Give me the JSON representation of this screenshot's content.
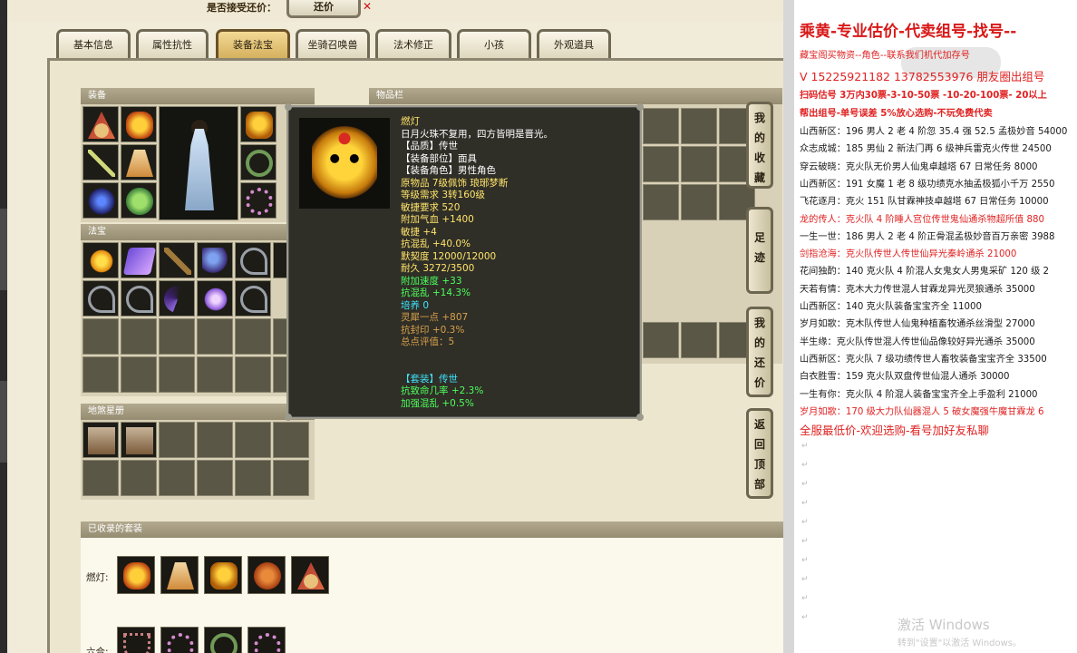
{
  "topbar": {
    "accept_label": "是否接受还价：",
    "accept_button": "还价",
    "close": "✕"
  },
  "tabs": [
    "基本信息",
    "属性抗性",
    "装备法宝",
    "坐骑召唤兽",
    "法术修正",
    "小孩",
    "外观道具"
  ],
  "sections": {
    "equipment": "装备",
    "treasure": "法宝",
    "items_bar": "物品栏",
    "pet_chart": "地煞星册",
    "collected_suits": "已收录的套装"
  },
  "suits": [
    {
      "label": "燃灯:"
    },
    {
      "label": "六合:"
    }
  ],
  "side_buttons": [
    {
      "label": "我的收藏",
      "chars": [
        "我",
        "的",
        "收",
        "藏"
      ]
    },
    {
      "label": "足迹",
      "chars": [
        "足",
        "迹"
      ]
    },
    {
      "label": "我的还价",
      "chars": [
        "我",
        "的",
        "还",
        "价"
      ]
    },
    {
      "label": "返回顶部",
      "chars": [
        "返",
        "回",
        "顶",
        "部"
      ]
    }
  ],
  "tooltip": {
    "lines": [
      {
        "text": "燃灯",
        "color": "#ffe46b"
      },
      {
        "text": "日月火珠不复用，四方皆明是晋光。",
        "color": "#ffffff"
      },
      {
        "text": "【品质】传世",
        "color": "#ffffff"
      },
      {
        "text": "【装备部位】面具",
        "color": "#ffffff"
      },
      {
        "text": "【装备角色】男性角色",
        "color": "#ffffff"
      },
      {
        "text": "原物品 7级佩饰 琅琊梦断",
        "color": "#ffe46b"
      },
      {
        "text": "等级需求 3转160级",
        "color": "#ffe46b"
      },
      {
        "text": "敏捷要求 520",
        "color": "#ffe46b"
      },
      {
        "text": "附加气血 +1400",
        "color": "#ffe46b"
      },
      {
        "text": "敏捷 +4",
        "color": "#ffe46b"
      },
      {
        "text": "抗混乱 +40.0%",
        "color": "#ffe46b"
      },
      {
        "text": "默契度 12000/12000",
        "color": "#ffe46b"
      },
      {
        "text": "耐久 3272/3500",
        "color": "#ffe46b"
      },
      {
        "text": "附加速度 +33",
        "color": "#4dff5c"
      },
      {
        "text": "抗混乱 +14.3%",
        "color": "#4dff5c"
      },
      {
        "text": "培养 0",
        "color": "#3ee6ff"
      },
      {
        "text": "灵犀一点 +807",
        "color": "#d7a14c"
      },
      {
        "text": "抗封印 +0.3%",
        "color": "#d7a14c"
      },
      {
        "text": "总点评值：5",
        "color": "#d7a14c"
      },
      {
        "text": "",
        "color": "#ffffff"
      },
      {
        "text": "",
        "color": "#ffffff"
      },
      {
        "text": "【套装】传世",
        "color": "#3ee6ff"
      },
      {
        "text": "抗致命几率 +2.3%",
        "color": "#4dff5c"
      },
      {
        "text": "加强混乱 +0.5%",
        "color": "#4dff5c"
      }
    ]
  },
  "document": {
    "title": "乘黄-专业估价-代卖组号-找号--",
    "lines": [
      {
        "text": "藏宝阁买物资--角色--联系我们机代加存号",
        "style": "red"
      },
      {
        "text": "V 15225921182    13782553976 朋友圈出组号",
        "style": "red big"
      },
      {
        "text": "扫码估号 3万内30票-3-10-50票  -10-20-100票- 20以上",
        "style": "redb"
      },
      {
        "text": "帮出组号-单号误差 5%放心选购-不玩免费代卖",
        "style": "redb"
      },
      {
        "text": "山西新区：196 男人 2 老 4 阶忽 35.4 强 52.5 孟极妙音 54000",
        "style": ""
      },
      {
        "text": "众志成城：185 男仙 2 新法门再 6 级神兵雷克火传世 24500",
        "style": ""
      },
      {
        "text": "穿云破晓：克火队无价男人仙鬼卓越塔 67 日常任务 8000",
        "style": ""
      },
      {
        "text": "山西新区：191 女魔 1 老 8 级功绩克水抽孟极狐小千万 2550",
        "style": ""
      },
      {
        "text": "飞花逐月：克火 151 队甘霖神技卓越塔 67 日常任务 10000",
        "style": ""
      },
      {
        "text": "龙的传人：克火队 4 阶睡人宫位传世鬼仙通杀物超所值 880",
        "style": "red"
      },
      {
        "text": "一生一世：186 男人 2 老 4 阶正骨混孟极妙音百万亲密 3988",
        "style": ""
      },
      {
        "text": "剑指沧海：克火队传世人传世仙异光秦岭通杀 21000",
        "style": "red"
      },
      {
        "text": "花间独酌：140 克火队 4 阶混人女鬼女人男鬼采矿 120 级 2",
        "style": ""
      },
      {
        "text": "天若有情：克木大力传世混人甘霖龙异光灵狼通杀 35000",
        "style": ""
      },
      {
        "text": "山西新区：140 克火队装备宝宝齐全 11000",
        "style": ""
      },
      {
        "text": "岁月如歌：克木队传世人仙鬼种植畜牧通杀丝滑型 27000",
        "style": ""
      },
      {
        "text": "半生缘：克火队传世混人传世仙品像较好异光通杀 35000",
        "style": ""
      },
      {
        "text": "山西新区：克火队 7 级功绩传世人畜牧装备宝宝齐全 33500",
        "style": ""
      },
      {
        "text": "白衣胜雪：159 克火队双盘传世仙混人通杀 30000",
        "style": ""
      },
      {
        "text": "一生有你：克火队 4 阶混人装备宝宝齐全上手盈利 21000",
        "style": ""
      },
      {
        "text": "岁月如歌：170 级大力队仙器混人 5 破女魔强牛魔甘霖龙 6",
        "style": "red"
      },
      {
        "text": "全服最低价-欢迎选购-看号加好友私聊",
        "style": "red big"
      }
    ],
    "watermark_title": "激活 Windows",
    "watermark_sub": "转到\"设置\"以激活 Windows。"
  },
  "colors": {
    "accent_red": "#e02222",
    "tooltip_bg": "#2f2e27",
    "tab_active": "#d4ae5b"
  }
}
